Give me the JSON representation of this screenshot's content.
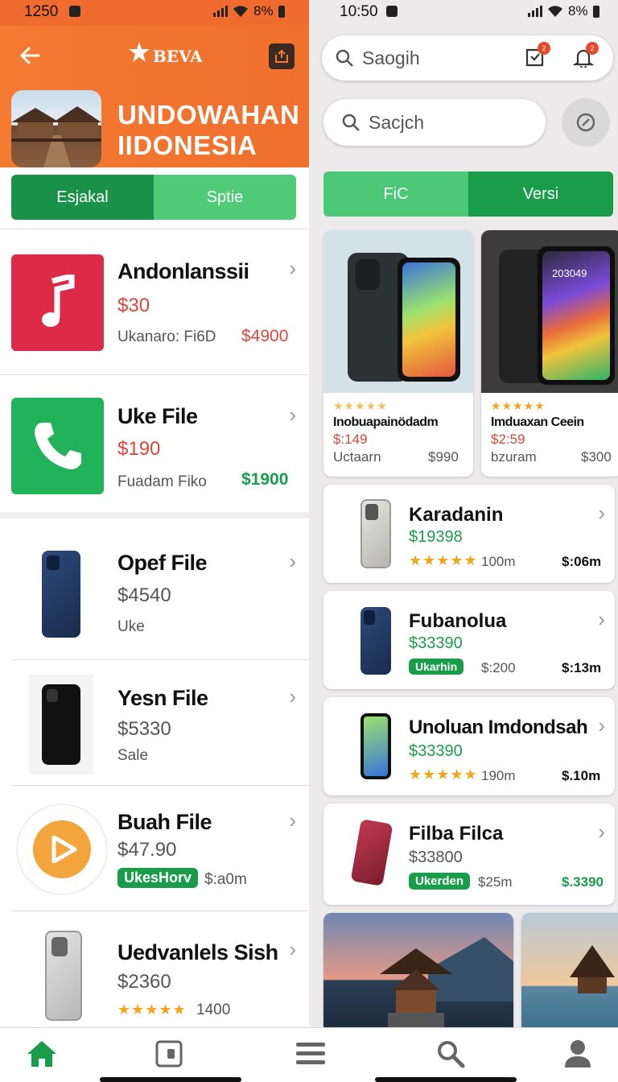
{
  "left": {
    "status": {
      "time": "1250",
      "battery": "8%"
    },
    "header": {
      "logo_text": "BEVA",
      "title_line1": "UNDOWAHAN",
      "title_line2": "IIDONESIA"
    },
    "segments": [
      "Esjakal",
      "Sptie"
    ],
    "items": [
      {
        "title": "Andonlanssii",
        "price": "$30",
        "sub": "Ukanaro: Fi6D",
        "right_price": "$4900",
        "icon": "music-note-icon"
      },
      {
        "title": "Uke File",
        "price": "$190",
        "sub": "Fuadam Fiko",
        "right_price": "$1900",
        "icon": "phone-icon"
      },
      {
        "title": "Opef File",
        "price": "$4540",
        "sub": "Uke"
      },
      {
        "title": "Yesn File",
        "price": "$5330",
        "sub": "Sale"
      },
      {
        "title": "Buah File",
        "price": "$47.90",
        "pill": "UkesHorv",
        "meta": "$:a0m",
        "icon": "play-icon"
      },
      {
        "title": "Uedvanlels Sish",
        "price": "$2360",
        "stars": "★★★★★",
        "meta": "1400"
      }
    ]
  },
  "right": {
    "status": {
      "time": "10:50",
      "battery": "8%"
    },
    "top_search": {
      "placeholder": "Saogih"
    },
    "search": {
      "placeholder": "Sacjch"
    },
    "badges": {
      "cart": "2",
      "bell": "2"
    },
    "segments": [
      "FiC",
      "Versi"
    ],
    "grid": [
      {
        "stars": "★★★★★",
        "title": "Inobuapainödadm",
        "price": "$:149",
        "sub": "Uctaarn",
        "right": "$990"
      },
      {
        "stars": "★★★★★",
        "title": "Imduaxan Ceein",
        "price": "$2:59",
        "sub": "bzuram",
        "right": "$300",
        "screen_time": "203049"
      }
    ],
    "list": [
      {
        "title": "Karadanin",
        "price": "$19398",
        "stars": "★★★★★",
        "meta": "100m",
        "right": "$:06m"
      },
      {
        "title": "Fubanolua",
        "price": "$33390",
        "pill": "Ukarhin",
        "meta": "$:200",
        "right": "$:13m"
      },
      {
        "title": "Unoluan Imdondsah",
        "price": "$33390",
        "stars": "★★★★★",
        "meta": "190m",
        "right": "$.10m"
      },
      {
        "title": "Filba Filca",
        "price": "$33800",
        "pill": "Ukerden",
        "meta": "$25m",
        "right": "$.3390"
      }
    ]
  },
  "colors": {
    "orange": "#f06b2e",
    "green": "#1a9d4a",
    "price_red": "#d9463a",
    "star": "#f0a51b"
  }
}
